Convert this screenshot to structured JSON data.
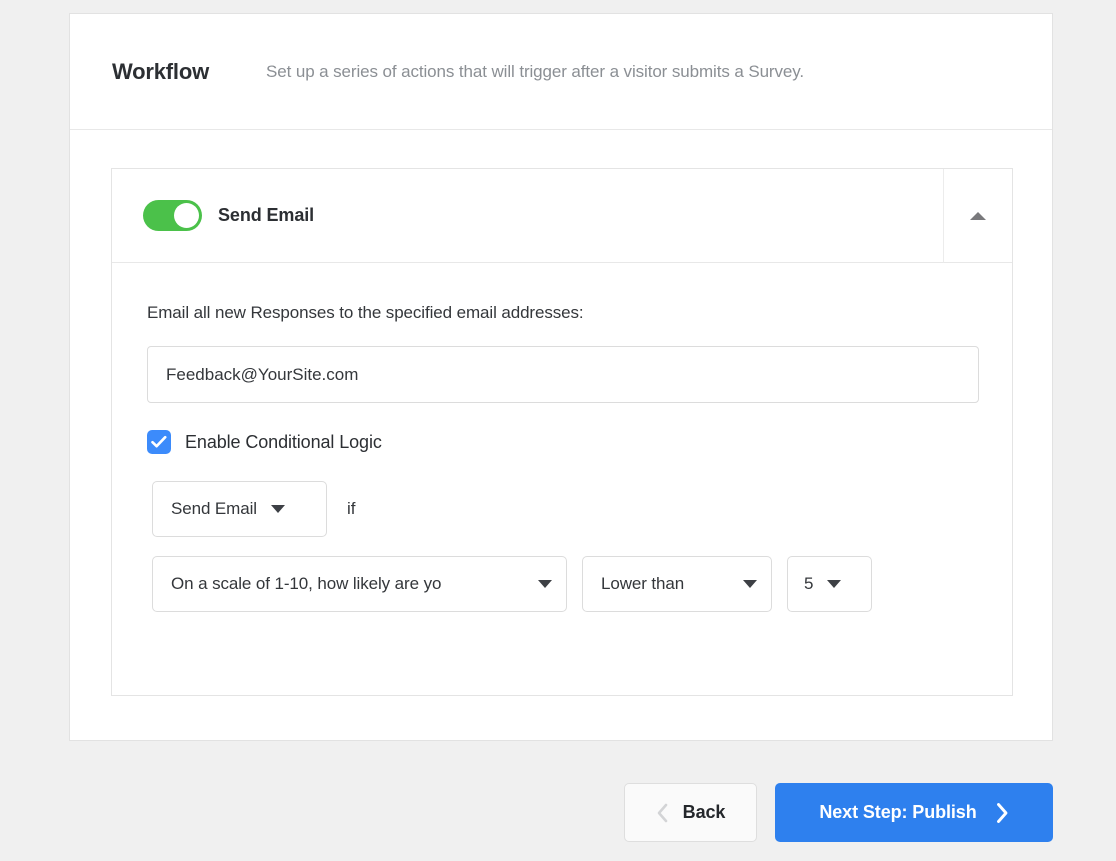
{
  "header": {
    "title": "Workflow",
    "subtitle": "Set up a series of actions that will trigger after a visitor submits a Survey."
  },
  "action_panel": {
    "toggle_label": "Send Email",
    "toggle_state": "on",
    "collapse_icon": "caret-up-icon",
    "body_text": "Email all new Responses to the specified email addresses:",
    "email_field": {
      "value": "Feedback@YourSite.com",
      "placeholder": "Feedback@YourSite.com"
    },
    "conditional": {
      "checkbox_label": "Enable Conditional Logic",
      "checkbox_checked": true,
      "action_select": "Send Email",
      "if_word": "if",
      "field_select": "On a scale of 1-10, how likely are yo",
      "operator_select": "Lower than",
      "value_select": "5"
    }
  },
  "footer": {
    "back_label": "Back",
    "next_label": "Next Step: Publish"
  },
  "colors": {
    "page_bg": "#f0f0f0",
    "toggle_green": "#4bc14a",
    "checkbox_blue": "#3c8bfb",
    "primary_blue": "#2e80ee",
    "title_dark": "#2c2f33",
    "subtitle_gray": "#8b8f94"
  }
}
